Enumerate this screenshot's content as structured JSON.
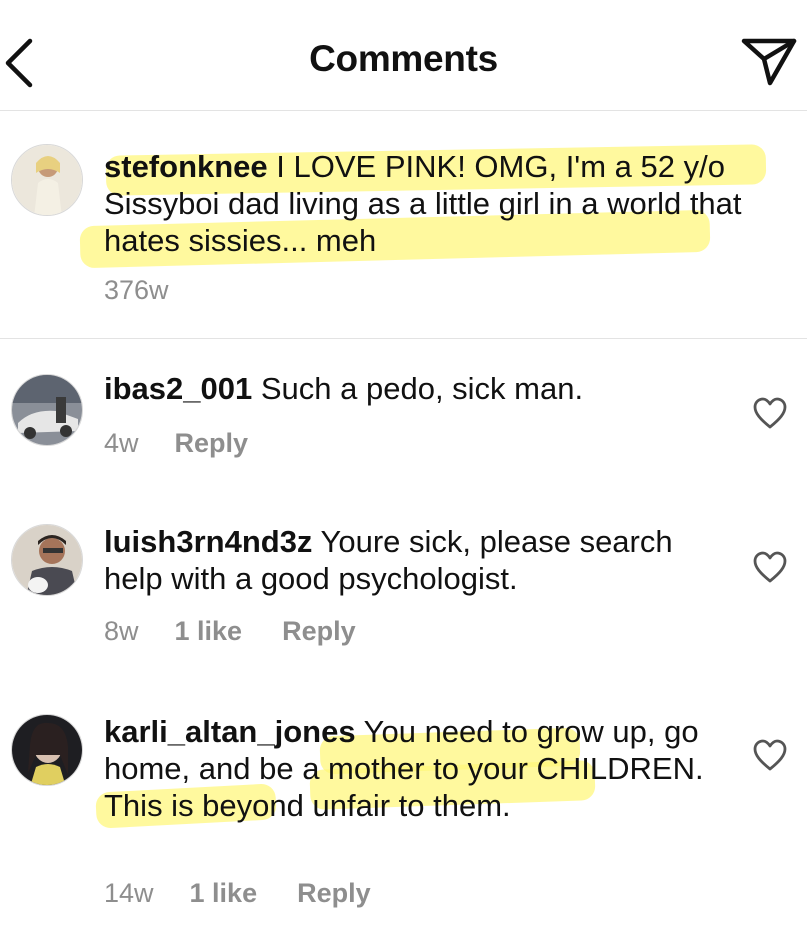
{
  "header": {
    "title": "Comments",
    "back_icon": "chevron-left-icon",
    "send_icon": "paper-plane-icon"
  },
  "colors": {
    "highlight": "#fff778",
    "meta_text": "#8e8e8e",
    "divider": "#e3e3e3"
  },
  "caption": {
    "username": "stefonknee",
    "text": "I LOVE PINK! OMG, I'm a 52 y/o Sissyboi dad living as a little girl in a world that hates sissies... meh",
    "time": "376w"
  },
  "comments": [
    {
      "username": "ibas2_001",
      "text": "Such a pedo, sick man.",
      "time": "4w",
      "likes": "",
      "reply": "Reply"
    },
    {
      "username": "luish3rn4nd3z",
      "text": "Youre sick, please search help with a good  psychologist.",
      "time": "8w",
      "likes": "1 like",
      "reply": "Reply"
    },
    {
      "username": "karli_altan_jones",
      "text": "You need to grow up, go home, and be a mother to your CHILDREN. This is beyond unfair to them.",
      "time": "14w",
      "likes": "1 like",
      "reply": "Reply"
    }
  ]
}
